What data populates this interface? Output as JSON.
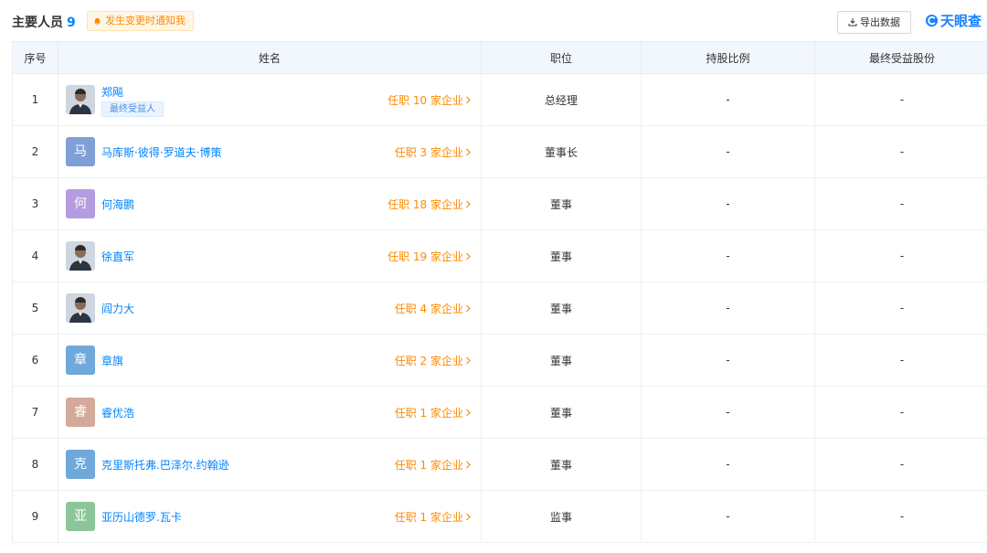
{
  "header": {
    "title": "主要人员",
    "count": "9",
    "notify_label": "发生变更时通知我",
    "export_label": "导出数据",
    "logo_text": "天眼查"
  },
  "table": {
    "columns": [
      "序号",
      "姓名",
      "职位",
      "持股比例",
      "最终受益股份"
    ],
    "rows": [
      {
        "index": "1",
        "avatar": "photo",
        "name": "郑飚",
        "tag": "最终受益人",
        "posts": "任职 10 家企业",
        "position": "总经理",
        "share_ratio": "-",
        "final_benefit": "-"
      },
      {
        "index": "2",
        "avatar": "马",
        "avatar_color": "#7f9fd6",
        "name": "马库斯·彼得·罗道夫·博策",
        "posts": "任职 3 家企业",
        "position": "董事长",
        "share_ratio": "-",
        "final_benefit": "-"
      },
      {
        "index": "3",
        "avatar": "何",
        "avatar_color": "#b59ce0",
        "name": "何海鹏",
        "posts": "任职 18 家企业",
        "position": "董事",
        "share_ratio": "-",
        "final_benefit": "-"
      },
      {
        "index": "4",
        "avatar": "photo",
        "name": "徐直军",
        "posts": "任职 19 家企业",
        "position": "董事",
        "share_ratio": "-",
        "final_benefit": "-"
      },
      {
        "index": "5",
        "avatar": "photo",
        "name": "阎力大",
        "posts": "任职 4 家企业",
        "position": "董事",
        "share_ratio": "-",
        "final_benefit": "-"
      },
      {
        "index": "6",
        "avatar": "章",
        "avatar_color": "#6fa8db",
        "name": "章旗",
        "posts": "任职 2 家企业",
        "position": "董事",
        "share_ratio": "-",
        "final_benefit": "-"
      },
      {
        "index": "7",
        "avatar": "睿",
        "avatar_color": "#d4a99a",
        "name": "睿优浩",
        "posts": "任职 1 家企业",
        "position": "董事",
        "share_ratio": "-",
        "final_benefit": "-"
      },
      {
        "index": "8",
        "avatar": "克",
        "avatar_color": "#6fa8db",
        "name": "克里斯托弗.巴泽尔.约翰逊",
        "posts": "任职 1 家企业",
        "position": "董事",
        "share_ratio": "-",
        "final_benefit": "-"
      },
      {
        "index": "9",
        "avatar": "亚",
        "avatar_color": "#8cc59a",
        "name": "亚历山德罗.瓦卡",
        "posts": "任职 1 家企业",
        "position": "监事",
        "share_ratio": "-",
        "final_benefit": "-"
      }
    ]
  },
  "colors": {
    "link": "#0084ff",
    "orange": "#ff8a00",
    "header_bg": "#f2f7fd"
  }
}
